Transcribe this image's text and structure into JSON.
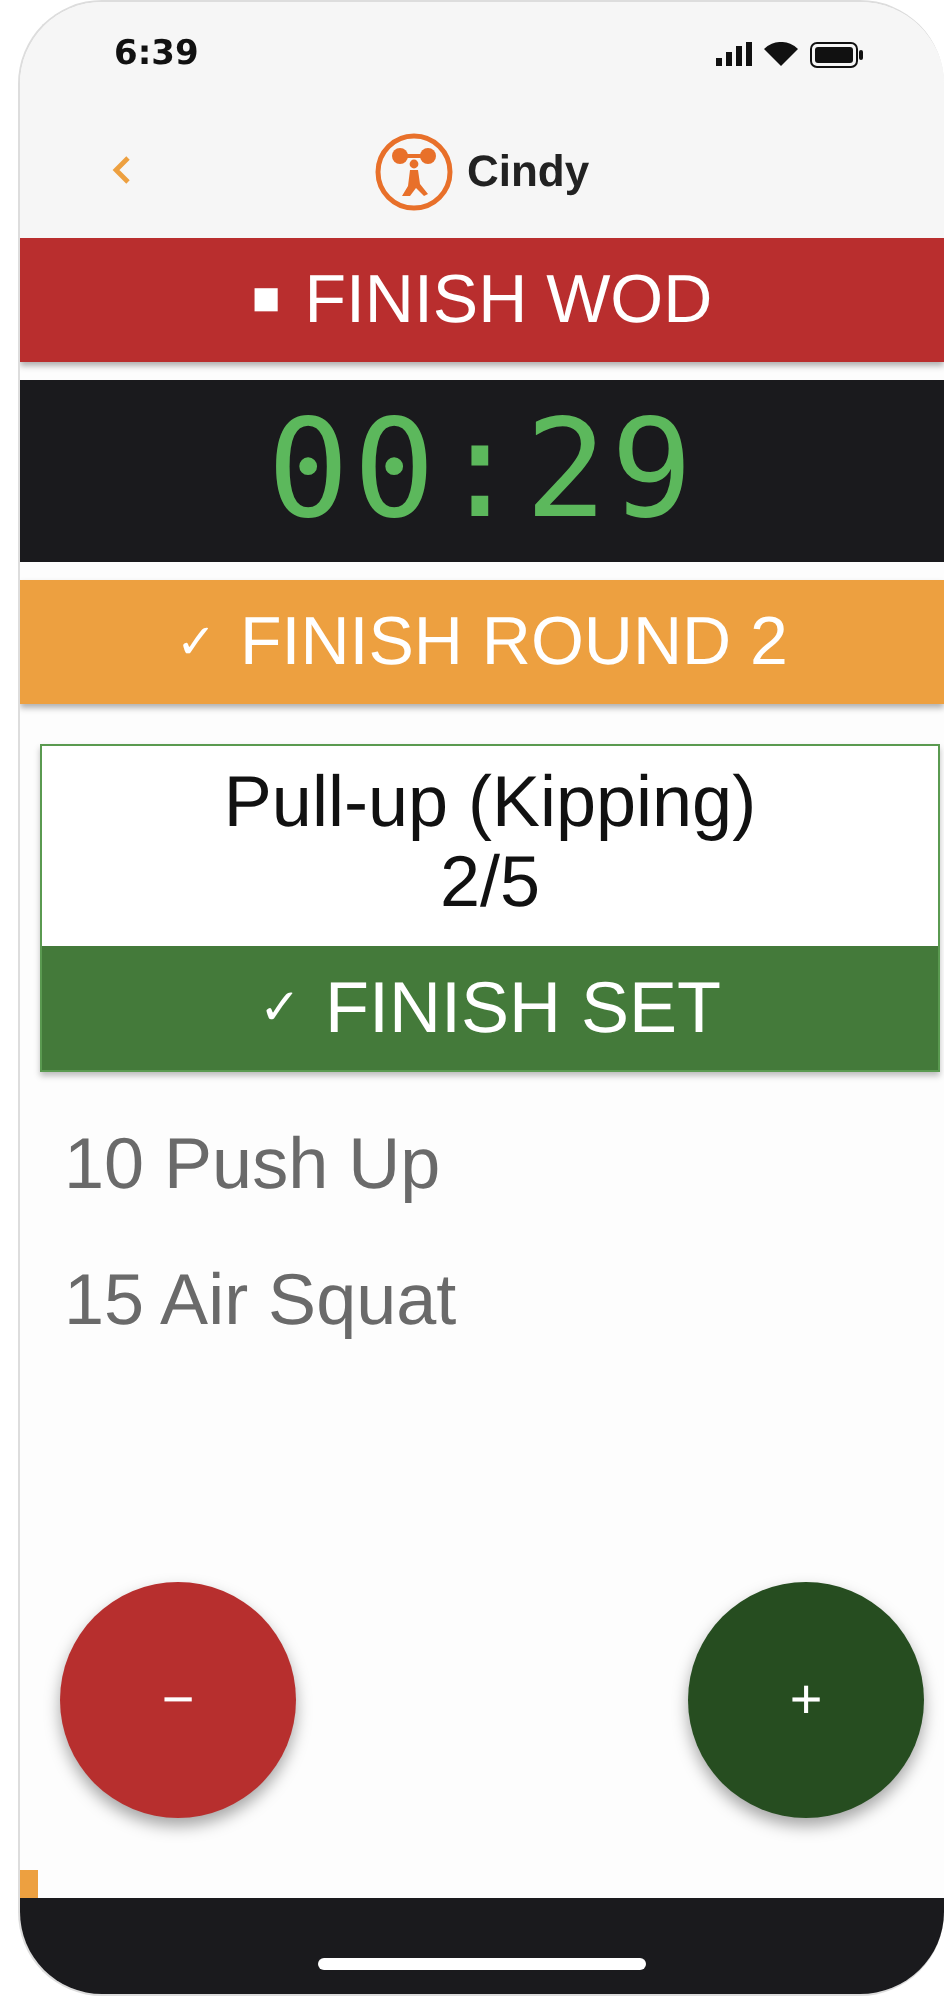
{
  "status_bar": {
    "time": "6:39"
  },
  "nav": {
    "title": "Cindy"
  },
  "finish_wod": {
    "icon": "■",
    "label": "FINISH WOD"
  },
  "timer": {
    "display": "00:29"
  },
  "finish_round": {
    "icon": "✓",
    "label": "FINISH ROUND 2"
  },
  "current_set": {
    "exercise": "Pull-up (Kipping)",
    "progress": "2/5",
    "button": {
      "icon": "✓",
      "label": "FINISH SET"
    }
  },
  "upcoming": [
    "10 Push Up",
    "15 Air Squat"
  ],
  "fabs": [
    {
      "kind": "decrement",
      "symbol": "−"
    },
    {
      "kind": "increment",
      "symbol": "+"
    }
  ],
  "progress": {
    "level": 0.02
  }
}
